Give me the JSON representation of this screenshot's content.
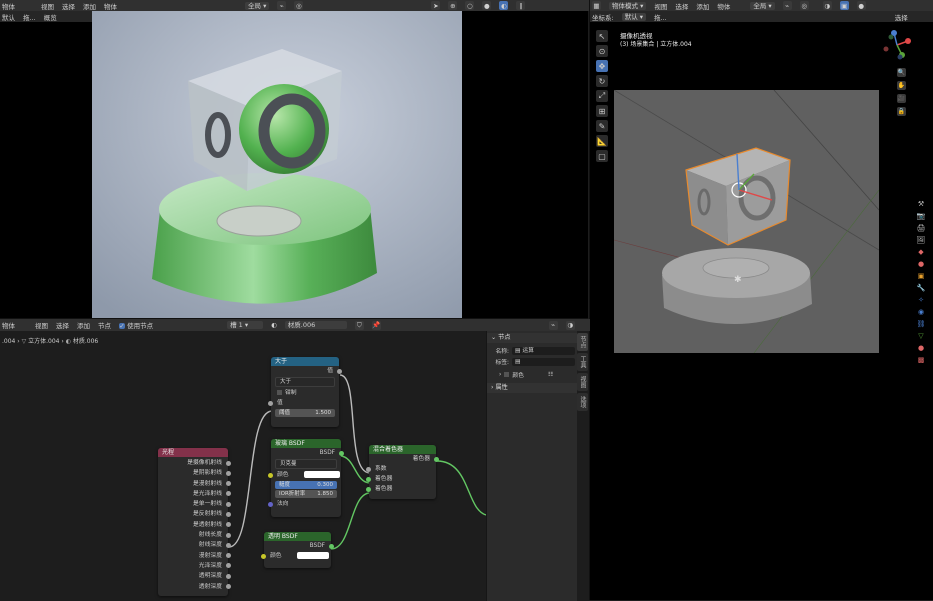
{
  "render_header": {
    "mode": "物体",
    "view": "视图",
    "select": "选择",
    "add": "添加",
    "obj": "物体",
    "filter": "默认",
    "sel": "选择",
    "misc": "拖...",
    "all": "概览",
    "global": "全局"
  },
  "viewport_header": {
    "mode": "物体模式",
    "view": "视图",
    "select": "选择",
    "add": "添加",
    "object": "物体",
    "orient_label": "坐标系:",
    "orient": "默认",
    "drag": "拖...",
    "select_box": "选择",
    "global": "全局"
  },
  "viewport": {
    "title": "摄像机透视",
    "subtitle": "(3) 场景集合 | 立方体.004"
  },
  "node_header": {
    "mode": "物体",
    "view": "视图",
    "select": "选择",
    "add": "添加",
    "node": "节点",
    "use_nodes": "使用节点",
    "slot": "槽 1",
    "material": "材质.006"
  },
  "breadcrumb": {
    "a": ".004",
    "b": "立方体.004",
    "c": "材质.006"
  },
  "sidebar": {
    "title": "节点",
    "name_label": "名称:",
    "name_value": "运算",
    "label_label": "标签:",
    "color_label": "颜色",
    "props_label": "属性",
    "tabs": [
      "节点",
      "工具",
      "视图",
      "选项"
    ]
  },
  "nodes": {
    "greater": {
      "title": "大于",
      "out": "值",
      "op": "大于",
      "clamp": "钳制",
      "in": "值",
      "thr_label": "阈值",
      "thr_value": "1.500"
    },
    "glass": {
      "title": "玻璃 BSDF",
      "out": "BSDF",
      "dist": "贝克曼",
      "color": "颜色",
      "rough_label": "糙度",
      "rough_value": "0.300",
      "ior_label": "IOR折射率",
      "ior_value": "1.850",
      "normal": "法向"
    },
    "mix": {
      "title": "混合着色器",
      "out": "着色器",
      "fac": "系数",
      "s1": "着色器",
      "s2": "着色器"
    },
    "transparent": {
      "title": "透明 BSDF",
      "out": "BSDF",
      "color": "颜色"
    },
    "lightpath": {
      "title": "光程",
      "outs": [
        "是摄像机射线",
        "是阴影射线",
        "是漫射射线",
        "是光泽射线",
        "是单一射线",
        "是反射射线",
        "是透射射线",
        "射线长度",
        "射线深度",
        "漫射深度",
        "光泽深度",
        "透明深度",
        "透射深度"
      ]
    }
  },
  "colors": {
    "accent": "#4772b3",
    "converter": "#246283",
    "shader": "#2b652b",
    "input": "#83314a"
  }
}
